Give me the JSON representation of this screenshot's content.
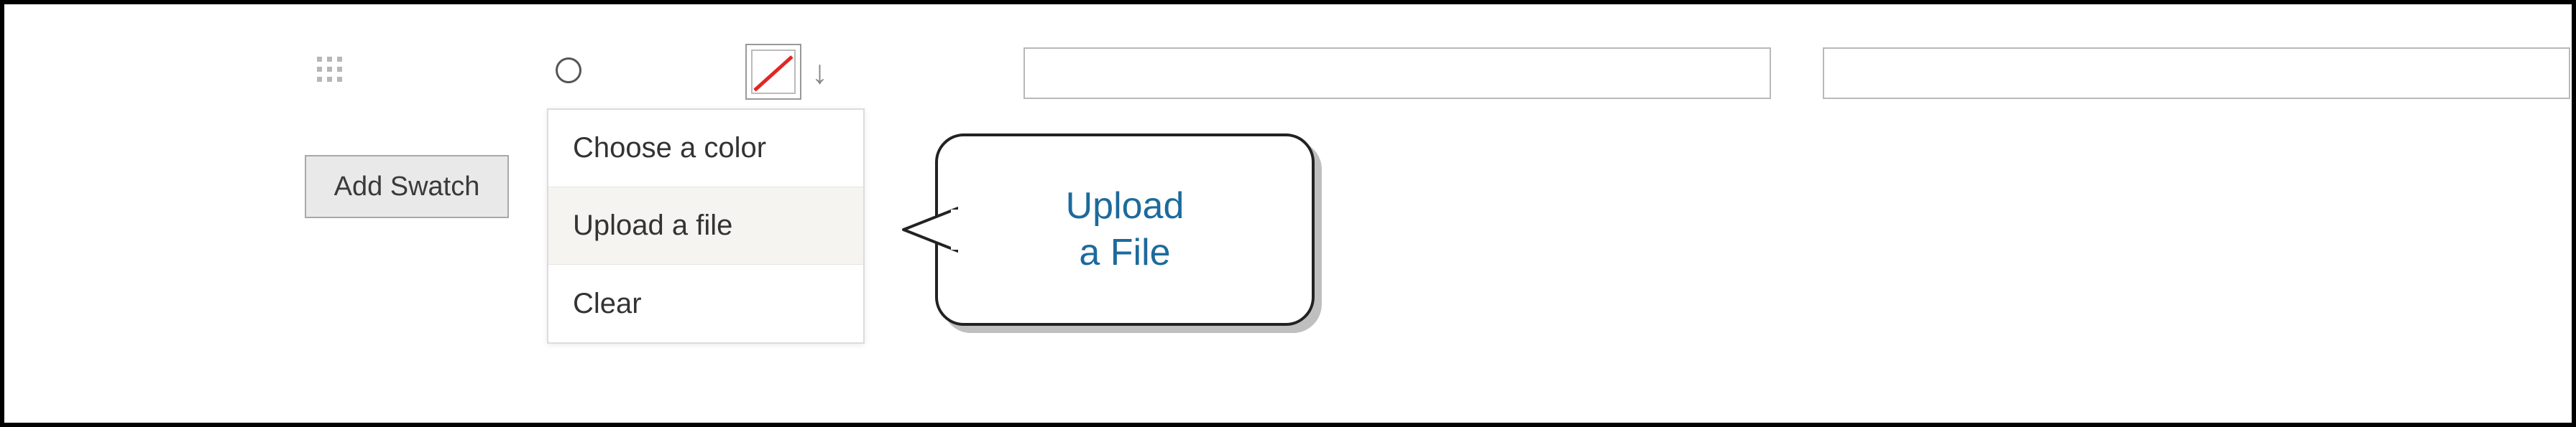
{
  "toolbar": {
    "add_swatch_label": "Add Swatch"
  },
  "dropdown": {
    "choose_color": "Choose a color",
    "upload_file": "Upload a file",
    "clear": "Clear"
  },
  "callout": {
    "text": "Upload\na File"
  },
  "inputs": {
    "input1_value": "",
    "input2_value": ""
  },
  "swatch": {
    "state": "none"
  }
}
